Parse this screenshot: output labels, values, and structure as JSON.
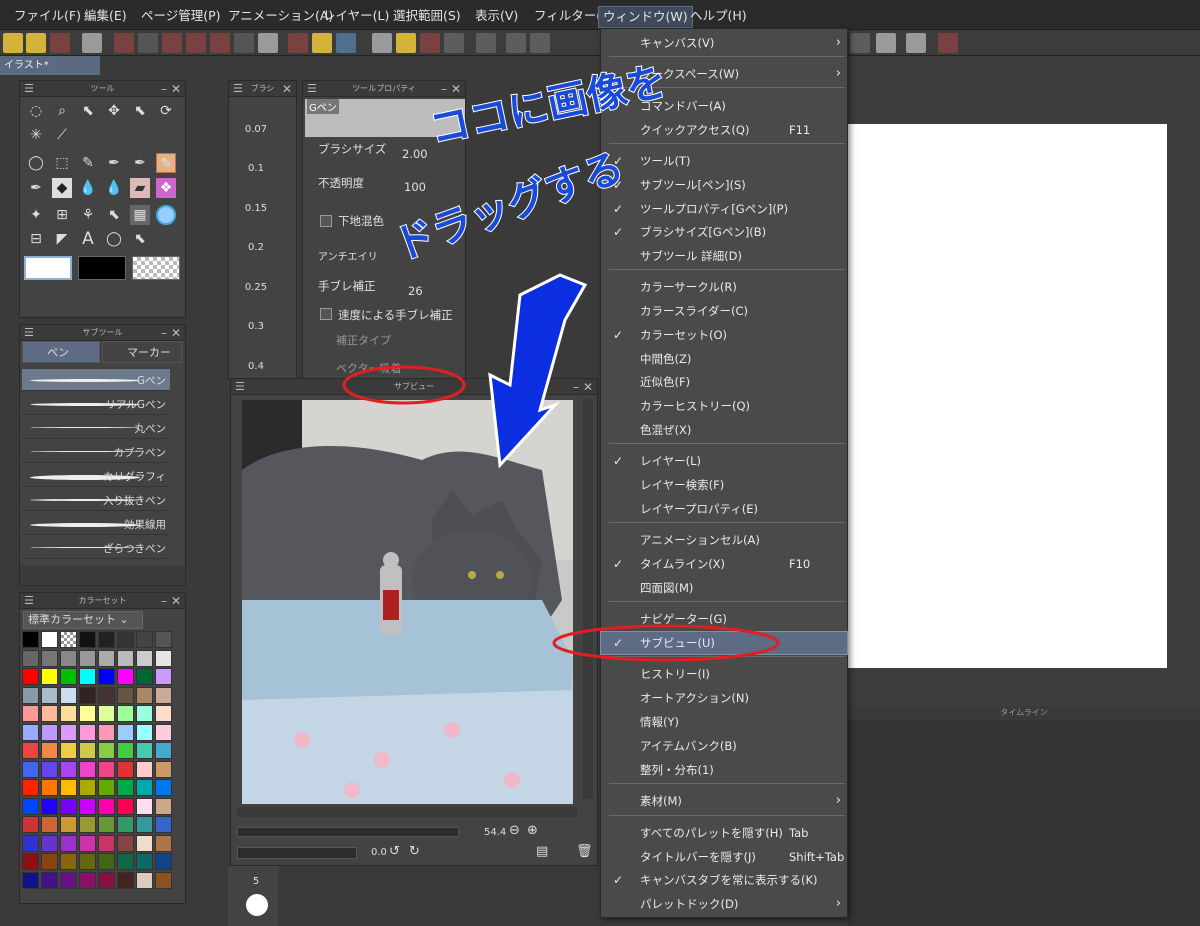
{
  "menubar": {
    "items": [
      "ファイル(F)",
      "編集(E)",
      "ページ管理(P)",
      "アニメーション(A)",
      "レイヤー(L)",
      "選択範囲(S)",
      "表示(V)",
      "フィルター(I)",
      "ウィンドウ(W)",
      "ヘルプ(H)"
    ],
    "active": "ウィンドウ(W)"
  },
  "document_tab": {
    "label": "イラスト*"
  },
  "tool_panel": {
    "title": "ツール"
  },
  "brushsize_panel": {
    "title": "ブラシ",
    "sizes": [
      "0.07",
      "0.1",
      "0.15",
      "0.2",
      "0.25",
      "0.3",
      "0.4"
    ],
    "bottom_size": "5"
  },
  "toolprop_panel": {
    "title": "ツールプロパティ",
    "tool_name": "Gペン",
    "brush_size_label": "ブラシサイズ",
    "brush_size_value": "2.00",
    "opacity_label": "不透明度",
    "opacity_value": "100",
    "underlay_label": "下地混色",
    "antialias_label": "アンチエイリ",
    "stabilize_label": "手ブレ補正",
    "stabilize_value": "26",
    "speed_stabilize_label": "速度による手ブレ補正",
    "correction_type_label": "補正タイプ",
    "vector_label": "ベクター吸着"
  },
  "subtool_panel": {
    "title": "サブツール",
    "tabs": [
      "ペン",
      "マーカー"
    ],
    "brushes": [
      "Gペン",
      "リアルGペン",
      "丸ペン",
      "カブラペン",
      "カリグラフィ",
      "入り抜きペン",
      "効果線用",
      "ざらつきペン"
    ]
  },
  "colorset_panel": {
    "title": "カラーセット",
    "set_name": "標準カラーセット",
    "colors": [
      "#000000",
      "#ffffff",
      "#checker",
      "#111111",
      "#222222",
      "#333333",
      "#444444",
      "#555555",
      "#666666",
      "#777777",
      "#888888",
      "#999999",
      "#aaaaaa",
      "#bbbbbb",
      "#cccccc",
      "#e6e6e6",
      "#ff0000",
      "#ffff00",
      "#00c000",
      "#00ffff",
      "#0000ff",
      "#ff00ff",
      "#006633",
      "#cc99ff",
      "#8899aa",
      "#aabbcc",
      "#ccddee",
      "#332222",
      "#443333",
      "#665544",
      "#aa8866",
      "#ccaa99",
      "#ff9999",
      "#ffbb99",
      "#ffdd99",
      "#ffff99",
      "#ddff99",
      "#99ff99",
      "#99ffdd",
      "#ffddcc",
      "#99aaff",
      "#bb99ff",
      "#dd99ff",
      "#ff99dd",
      "#ff99bb",
      "#99ccff",
      "#99ffff",
      "#ffccdd",
      "#ee4444",
      "#ee8844",
      "#eecc44",
      "#cccc44",
      "#88cc44",
      "#44cc44",
      "#44ccaa",
      "#44aacc",
      "#4466ee",
      "#6644ee",
      "#aa44ee",
      "#ee44cc",
      "#ee4488",
      "#dd3333",
      "#ffcccc",
      "#cc9966",
      "#ff2200",
      "#ff7700",
      "#ffbb00",
      "#aaaa00",
      "#66aa00",
      "#00aa44",
      "#00aaaa",
      "#0077ee",
      "#0044ff",
      "#2200ff",
      "#7700ff",
      "#cc00ff",
      "#ff00aa",
      "#ff0055",
      "#ffddee",
      "#ccaa88",
      "#cc3333",
      "#cc6633",
      "#cc9933",
      "#999933",
      "#669933",
      "#339966",
      "#339999",
      "#3366cc",
      "#3333cc",
      "#6633cc",
      "#9933cc",
      "#cc33aa",
      "#cc3366",
      "#884444",
      "#eeddcc",
      "#aa7744",
      "#881111",
      "#884411",
      "#886611",
      "#666611",
      "#446611",
      "#116644",
      "#116666",
      "#114488",
      "#111188",
      "#441188",
      "#661188",
      "#881166",
      "#881144",
      "#442222",
      "#ddccbb",
      "#885522"
    ]
  },
  "subview_panel": {
    "title": "サブビュー",
    "zoom": "54.4",
    "angle": "0.0"
  },
  "window_menu": {
    "items": [
      {
        "label": "キャンバス(V)",
        "arrow": true
      },
      {
        "label": "ワークスペース(W)",
        "arrow": true
      },
      {
        "label": "コマンドバー(A)"
      },
      {
        "label": "クイックアクセス(Q)",
        "key": "F11"
      },
      {
        "label": "ツール(T)",
        "check": true
      },
      {
        "label": "サブツール[ペン](S)",
        "check": true
      },
      {
        "label": "ツールプロパティ[Gペン](P)",
        "check": true
      },
      {
        "label": "ブラシサイズ[Gペン](B)",
        "check": true
      },
      {
        "label": "サブツール 詳細(D)"
      },
      {
        "label": "カラーサークル(R)"
      },
      {
        "label": "カラースライダー(C)"
      },
      {
        "label": "カラーセット(O)",
        "check": true
      },
      {
        "label": "中間色(Z)"
      },
      {
        "label": "近似色(F)"
      },
      {
        "label": "カラーヒストリー(Q)"
      },
      {
        "label": "色混ぜ(X)"
      },
      {
        "label": "レイヤー(L)",
        "check": true
      },
      {
        "label": "レイヤー検索(F)"
      },
      {
        "label": "レイヤープロパティ(E)"
      },
      {
        "label": "アニメーションセル(A)"
      },
      {
        "label": "タイムライン(X)",
        "check": true,
        "key": "F10"
      },
      {
        "label": "四面図(M)"
      },
      {
        "label": "ナビゲーター(G)"
      },
      {
        "label": "サブビュー(U)",
        "check": true,
        "highlight": true
      },
      {
        "label": "ヒストリー(I)"
      },
      {
        "label": "オートアクション(N)"
      },
      {
        "label": "情報(Y)"
      },
      {
        "label": "アイテムバンク(B)"
      },
      {
        "label": "整列・分布(1)"
      },
      {
        "label": "素材(M)",
        "arrow": true
      },
      {
        "label": "すべてのパレットを隠す(H)",
        "key": "Tab"
      },
      {
        "label": "タイトルバーを隠す(J)",
        "key": "Shift+Tab"
      },
      {
        "label": "キャンバスタブを常に表示する(K)",
        "check": true
      },
      {
        "label": "パレットドック(D)",
        "arrow": true
      }
    ]
  },
  "timeline_label": "タイムライン",
  "annotation": {
    "line1": "ココに画像を",
    "line2": "ドラッグする",
    "color": "#1a4ad8",
    "circle_color": "#e02020"
  }
}
